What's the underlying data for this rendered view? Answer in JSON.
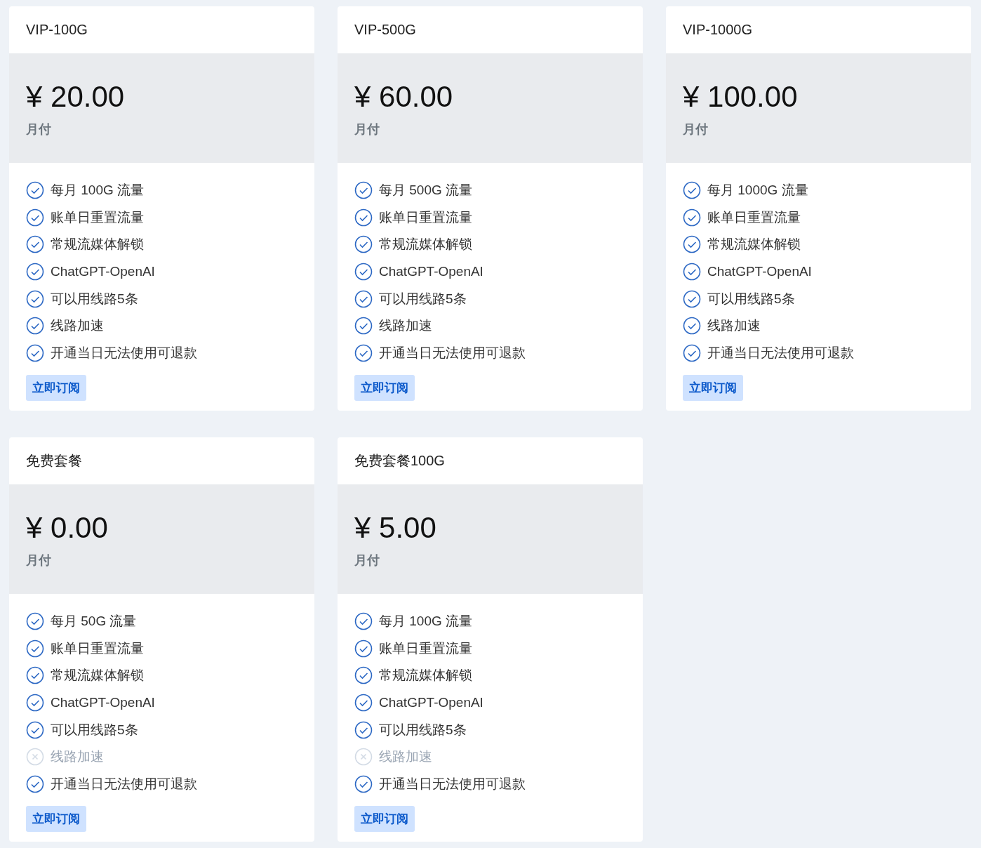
{
  "plans": [
    {
      "name": "VIP-100G",
      "price": "¥ 20.00",
      "period": "月付",
      "button": "立即订阅",
      "features": [
        {
          "text": "每月 100G 流量",
          "included": true
        },
        {
          "text": "账单日重置流量",
          "included": true
        },
        {
          "text": "常规流媒体解锁",
          "included": true
        },
        {
          "text": "ChatGPT-OpenAI",
          "included": true
        },
        {
          "text": "可以用线路5条",
          "included": true
        },
        {
          "text": "线路加速",
          "included": true
        },
        {
          "text": "开通当日无法使用可退款",
          "included": true
        }
      ]
    },
    {
      "name": "VIP-500G",
      "price": "¥ 60.00",
      "period": "月付",
      "button": "立即订阅",
      "features": [
        {
          "text": "每月 500G 流量",
          "included": true
        },
        {
          "text": "账单日重置流量",
          "included": true
        },
        {
          "text": "常规流媒体解锁",
          "included": true
        },
        {
          "text": "ChatGPT-OpenAI",
          "included": true
        },
        {
          "text": "可以用线路5条",
          "included": true
        },
        {
          "text": "线路加速",
          "included": true
        },
        {
          "text": "开通当日无法使用可退款",
          "included": true
        }
      ]
    },
    {
      "name": "VIP-1000G",
      "price": "¥ 100.00",
      "period": "月付",
      "button": "立即订阅",
      "features": [
        {
          "text": "每月 1000G 流量",
          "included": true
        },
        {
          "text": "账单日重置流量",
          "included": true
        },
        {
          "text": "常规流媒体解锁",
          "included": true
        },
        {
          "text": "ChatGPT-OpenAI",
          "included": true
        },
        {
          "text": "可以用线路5条",
          "included": true
        },
        {
          "text": "线路加速",
          "included": true
        },
        {
          "text": "开通当日无法使用可退款",
          "included": true
        }
      ]
    },
    {
      "name": "免费套餐",
      "price": "¥ 0.00",
      "period": "月付",
      "button": "立即订阅",
      "features": [
        {
          "text": "每月 50G 流量",
          "included": true
        },
        {
          "text": "账单日重置流量",
          "included": true
        },
        {
          "text": "常规流媒体解锁",
          "included": true
        },
        {
          "text": "ChatGPT-OpenAI",
          "included": true
        },
        {
          "text": "可以用线路5条",
          "included": true
        },
        {
          "text": "线路加速",
          "included": false
        },
        {
          "text": "开通当日无法使用可退款",
          "included": true
        }
      ]
    },
    {
      "name": "免费套餐100G",
      "price": "¥ 5.00",
      "period": "月付",
      "button": "立即订阅",
      "features": [
        {
          "text": "每月 100G 流量",
          "included": true
        },
        {
          "text": "账单日重置流量",
          "included": true
        },
        {
          "text": "常规流媒体解锁",
          "included": true
        },
        {
          "text": "ChatGPT-OpenAI",
          "included": true
        },
        {
          "text": "可以用线路5条",
          "included": true
        },
        {
          "text": "线路加速",
          "included": false
        },
        {
          "text": "开通当日无法使用可退款",
          "included": true
        }
      ]
    }
  ]
}
